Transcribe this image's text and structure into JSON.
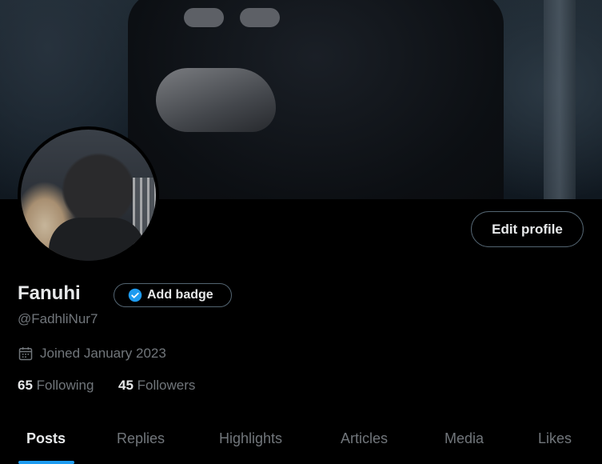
{
  "profile": {
    "name": "Fanuhi",
    "handle": "@FadhliNur7",
    "joined": "Joined January 2023",
    "badge_label": "Add badge",
    "edit_label": "Edit profile"
  },
  "stats": {
    "following_count": "65",
    "following_label": "Following",
    "followers_count": "45",
    "followers_label": "Followers"
  },
  "tabs": [
    {
      "label": "Posts",
      "active": true
    },
    {
      "label": "Replies"
    },
    {
      "label": "Highlights"
    },
    {
      "label": "Articles"
    },
    {
      "label": "Media"
    },
    {
      "label": "Likes"
    }
  ],
  "icons": {
    "badge": "verified-check-icon",
    "joined": "calendar-icon"
  },
  "colors": {
    "accent": "#1d9bf0",
    "background": "#000000",
    "muted_text": "#71767b",
    "border": "#536471"
  }
}
